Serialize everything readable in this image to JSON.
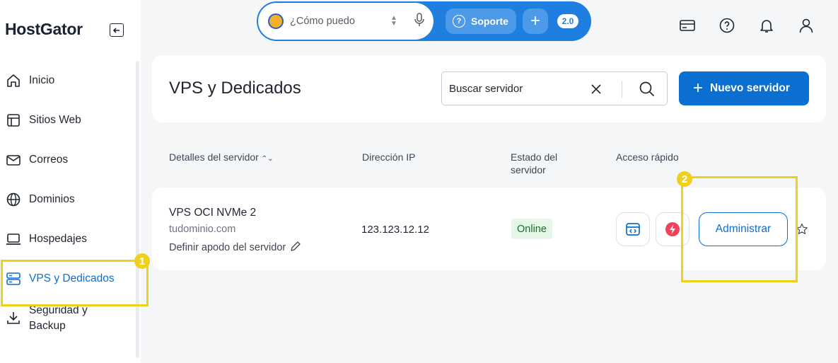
{
  "brand": {
    "logo_text": "HostGator"
  },
  "sidebar": {
    "items": [
      {
        "label": "Inicio",
        "icon": "home-icon"
      },
      {
        "label": "Sitios Web",
        "icon": "layout-icon"
      },
      {
        "label": "Correos",
        "icon": "mail-icon"
      },
      {
        "label": "Dominios",
        "icon": "globe-icon"
      },
      {
        "label": "Hospedajes",
        "icon": "laptop-icon"
      },
      {
        "label": "VPS y Dedicados",
        "icon": "server-icon",
        "active": true
      },
      {
        "label": "Seguridad y Backup",
        "icon": "download-icon"
      }
    ]
  },
  "topbar": {
    "assistant_placeholder": "¿Cómo puedo",
    "support_label": "Soporte",
    "version_badge": "2.0"
  },
  "header": {
    "title": "VPS y Dedicados",
    "search_placeholder": "Buscar servidor",
    "new_server_label": "Nuevo servidor"
  },
  "table": {
    "columns": [
      "Detalles del servidor",
      "Dirección IP",
      "Estado del servidor",
      "Acceso rápido"
    ],
    "rows": [
      {
        "name": "VPS OCI NVMe 2",
        "domain": "tudominio.com",
        "alias_link": "Definir apodo del servidor",
        "ip": "123.123.12.12",
        "status": "Online",
        "action_label": "Administrar"
      }
    ]
  },
  "annotations": {
    "marker_1": "1",
    "marker_2": "2"
  },
  "colors": {
    "accent": "#0b6ed1",
    "highlight": "#efd01b",
    "status_bg": "#e4f6e6"
  }
}
